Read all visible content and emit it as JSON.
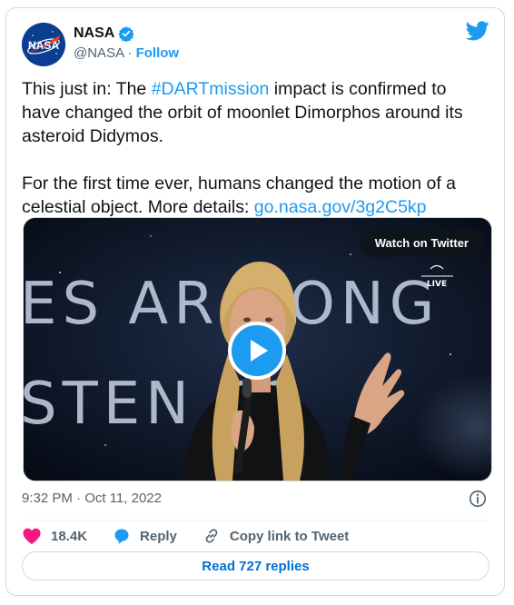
{
  "author": {
    "name": "NASA",
    "handle": "@NASA",
    "separator": "·",
    "follow_label": "Follow",
    "verified": true,
    "avatar_text": "NASA"
  },
  "tweet": {
    "line1_prefix": "This just in: The ",
    "hashtag": "#DARTmission",
    "line1_suffix": " impact is confirmed to have changed the orbit of moonlet Dimorphos around its asteroid Didymos.",
    "line2_prefix": "For the first time ever, humans changed the motion of a celestial object. More details: ",
    "link": "go.nasa.gov/3g2C5kp"
  },
  "media": {
    "watch_label": "Watch on Twitter",
    "live_label": "LIVE",
    "backdrop_text_top": "ES  AR   RONG",
    "backdrop_text_bottom": "STEN        ES"
  },
  "meta": {
    "timestamp": "9:32 PM · Oct 11, 2022"
  },
  "actions": {
    "likes": "18.4K",
    "reply_label": "Reply",
    "copy_label": "Copy link to Tweet"
  },
  "read_replies_label": "Read 727 replies",
  "colors": {
    "accent": "#1d9bf0",
    "like": "#f91880",
    "text": "#0f1419",
    "muted": "#536471"
  }
}
